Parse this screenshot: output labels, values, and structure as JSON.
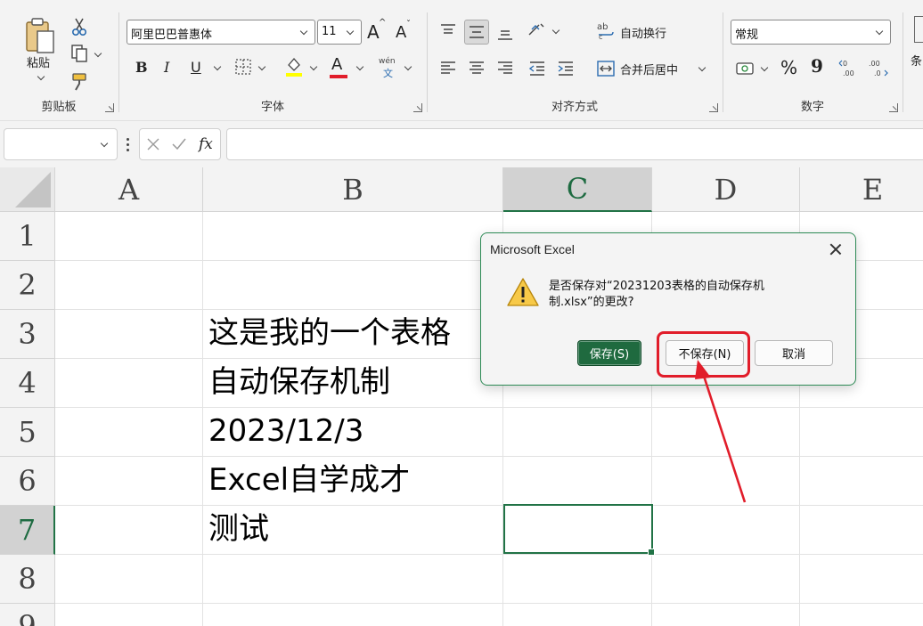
{
  "ribbon": {
    "clipboard": {
      "group_label": "剪贴板",
      "paste_label": "粘贴"
    },
    "font": {
      "group_label": "字体",
      "font_name": "阿里巴巴普惠体",
      "font_size": "11",
      "bold_label": "B",
      "italic_label": "I",
      "underline_label": "U",
      "grow_label": "A",
      "shrink_label": "A",
      "font_color_label": "A",
      "phonetic_top": "wén",
      "phonetic_bottom": "文"
    },
    "alignment": {
      "group_label": "对齐方式",
      "wrap_text": "自动换行",
      "merge_center": "合并后居中"
    },
    "number": {
      "group_label": "数字",
      "format": "常规",
      "percent": "%",
      "comma": "9"
    },
    "styles": {
      "partial_label": "条"
    }
  },
  "formula_bar": {
    "namebox_value": "",
    "fx_label": "fx",
    "formula_value": ""
  },
  "grid": {
    "columns": [
      "A",
      "B",
      "C",
      "D",
      "E"
    ],
    "rows": [
      "1",
      "2",
      "3",
      "4",
      "5",
      "6",
      "7",
      "8",
      "9"
    ],
    "selected_column": "C",
    "selected_row": "7",
    "cells": {
      "B3": "这是我的一个表格",
      "B4": "自动保存机制",
      "B5": "2023/12/3",
      "B6": "Excel自学成才",
      "B7": "测试"
    }
  },
  "dialog": {
    "title": "Microsoft Excel",
    "message": "是否保存对“20231203表格的自动保存机制.xlsx”的更改?",
    "save_button": "保存(S)",
    "dont_save_button": "不保存(N)",
    "cancel_button": "取消"
  },
  "colors": {
    "excel_green": "#217346",
    "annotation_red": "#e11d2a"
  }
}
